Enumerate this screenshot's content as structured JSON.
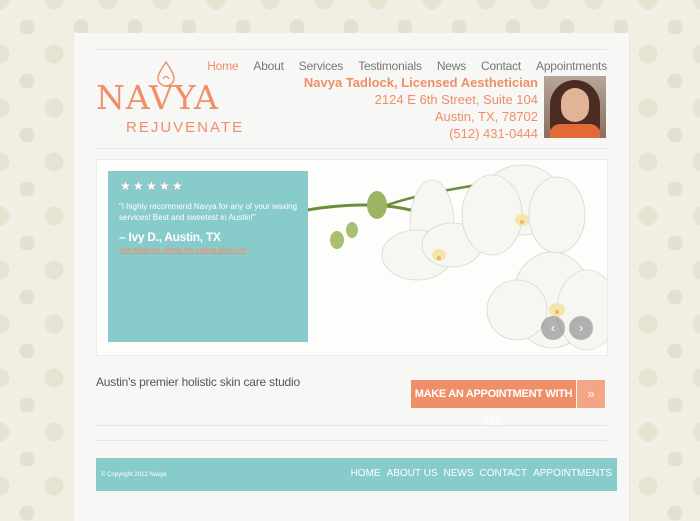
{
  "brand": {
    "name": "NAVYA",
    "subtitle": "REJUVENATE",
    "colors": {
      "accent": "#ef8f69",
      "teal": "#87cbcb"
    }
  },
  "nav": {
    "items": [
      {
        "label": "Home"
      },
      {
        "label": "About"
      },
      {
        "label": "Services"
      },
      {
        "label": "Testimonials"
      },
      {
        "label": "News"
      },
      {
        "label": "Contact"
      },
      {
        "label": "Appointments"
      }
    ],
    "active": "Home"
  },
  "contact": {
    "name": "Navya Tadlock, Licensed Aesthetician",
    "address": "2124 E 6th Street, Suite 104",
    "city": "Austin, TX, 78702",
    "phone": "(512) 431-0444"
  },
  "testimonial": {
    "rating": 5,
    "quote": "\"I highly recommend Navya for any of your waxing services! Best and sweetest in Austin!\"",
    "author": "– Ivy D., Austin, TX",
    "link": "See what our clients are saying about us!"
  },
  "slider": {
    "prev_icon": "chevron-left-icon",
    "next_icon": "chevron-right-icon",
    "prev_glyph": "‹",
    "next_glyph": "›"
  },
  "tagline": "Austin's premier holistic skin care studio",
  "cta": {
    "label": "MAKE AN APPOINTMENT WITH US!",
    "arrow": "»"
  },
  "footer": {
    "copyright": "© Copyright 2012 Navya",
    "links": [
      {
        "label": "HOME"
      },
      {
        "label": "ABOUT US"
      },
      {
        "label": "NEWS"
      },
      {
        "label": "CONTACT"
      },
      {
        "label": "APPOINTMENTS"
      }
    ]
  }
}
